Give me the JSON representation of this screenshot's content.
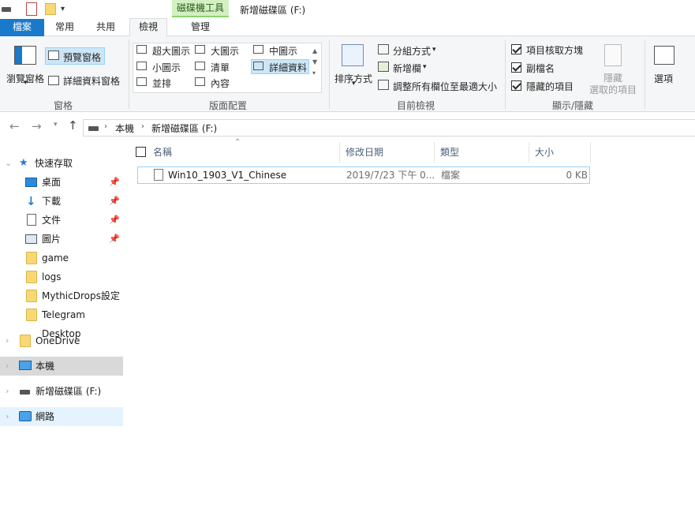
{
  "window": {
    "title": "新增磁碟區 (F:)",
    "tools_context": "磁碟機工具"
  },
  "tabs": {
    "file": "檔案",
    "home": "常用",
    "share": "共用",
    "view": "檢視",
    "manage": "管理"
  },
  "ribbon": {
    "panes": {
      "label": "窗格",
      "nav_pane": "瀏覽窗格",
      "preview_pane": "預覽窗格",
      "details_pane": "詳細資料窗格"
    },
    "layout": {
      "label": "版面配置",
      "items": [
        "超大圖示",
        "大圖示",
        "中圖示",
        "小圖示",
        "清單",
        "詳細資料",
        "並排",
        "內容"
      ]
    },
    "current_view": {
      "label": "目前檢視",
      "sort_by": "排序方式",
      "group_by": "分組方式",
      "add_columns": "新增欄",
      "size_columns": "調整所有欄位至最適大小"
    },
    "show_hide": {
      "label": "顯示/隱藏",
      "item_checkboxes": "項目核取方塊",
      "file_extensions": "副檔名",
      "hidden_items": "隱藏的項目",
      "hide_selected_1": "隱藏",
      "hide_selected_2": "選取的項目"
    },
    "options": {
      "label": "選項"
    }
  },
  "address": {
    "crumbs": [
      "本機",
      "新增磁碟區 (F:)"
    ]
  },
  "sidebar": {
    "quick_access": "快速存取",
    "pinned": [
      "桌面",
      "下載",
      "文件",
      "圖片"
    ],
    "folders": [
      "game",
      "logs",
      "MythicDrops設定",
      "Telegram Desktop"
    ],
    "onedrive": "OneDrive",
    "this_pc": "本機",
    "drive": "新增磁碟區 (F:)",
    "network": "網路"
  },
  "columns": {
    "name": "名稱",
    "date": "修改日期",
    "type": "類型",
    "size": "大小"
  },
  "files": [
    {
      "name": "Win10_1903_V1_Chinese",
      "date": "2019/7/23 下午 0...",
      "type": "檔案",
      "size": "0 KB"
    }
  ],
  "colors": {
    "file_tab": "#1979ca",
    "tools_header": "#d2f0c1",
    "selection_border": "#99d1ff",
    "folder": "#f8d775"
  }
}
